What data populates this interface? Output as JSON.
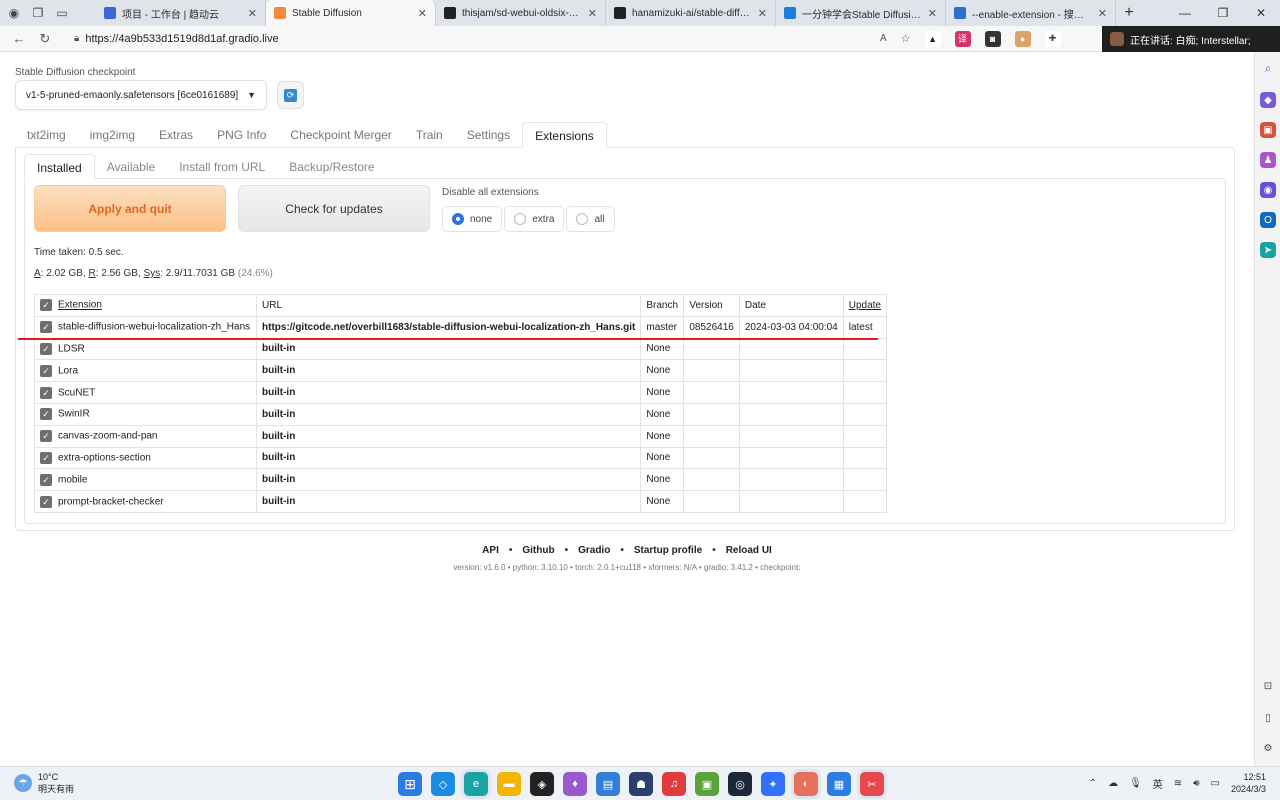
{
  "browser": {
    "tabs": [
      {
        "title": "项目 - 工作台 | 趋动云",
        "color": "#3a67d8",
        "active": false
      },
      {
        "title": "Stable Diffusion",
        "color": "#f08a3c",
        "active": true
      },
      {
        "title": "thisjam/sd-webui-oldsix-prom",
        "color": "#222222",
        "active": false
      },
      {
        "title": "hanamizuki-ai/stable-diffusion",
        "color": "#222222",
        "active": false
      },
      {
        "title": "一分钟学会Stable Diffusion设置",
        "color": "#1e7fe0",
        "active": false
      },
      {
        "title": "--enable-extension - 搜索 ---",
        "color": "#2d6fd6",
        "active": false
      }
    ],
    "url": "https://4a9b533d1519d8d1af.gradio.live",
    "speaking_text": "正在讲话:   白痴; Interstellar;"
  },
  "checkpoint": {
    "label": "Stable Diffusion checkpoint",
    "value": "v1-5-pruned-emaonly.safetensors [6ce0161689]"
  },
  "main_tabs": [
    "txt2img",
    "img2img",
    "Extras",
    "PNG Info",
    "Checkpoint Merger",
    "Train",
    "Settings",
    "Extensions"
  ],
  "sub_tabs": [
    "Installed",
    "Available",
    "Install from URL",
    "Backup/Restore"
  ],
  "buttons": {
    "apply": "Apply and quit",
    "check": "Check for updates"
  },
  "disable": {
    "label": "Disable all extensions",
    "options": [
      "none",
      "extra",
      "all"
    ],
    "selected": "none"
  },
  "status": {
    "time_taken": "Time taken: 0.5 sec.",
    "mem_a_label": "A",
    "mem_a": ": 2.02 GB, ",
    "mem_r_label": "R",
    "mem_r": ": 2.56 GB, ",
    "mem_sys_label": "Sys",
    "mem_sys": ": 2.9/11.7031 GB ",
    "mem_pct": "(24.6%)"
  },
  "table": {
    "headers": [
      "Extension",
      "URL",
      "Branch",
      "Version",
      "Date",
      "Update"
    ],
    "rows": [
      [
        "stable-diffusion-webui-localization-zh_Hans",
        "https://gitcode.net/overbill1683/stable-diffusion-webui-localization-zh_Hans.git",
        "master",
        "08526416",
        "2024-03-03 04:00:04",
        "latest"
      ],
      [
        "LDSR",
        "built-in",
        "None",
        "",
        "",
        ""
      ],
      [
        "Lora",
        "built-in",
        "None",
        "",
        "",
        ""
      ],
      [
        "ScuNET",
        "built-in",
        "None",
        "",
        "",
        ""
      ],
      [
        "SwinIR",
        "built-in",
        "None",
        "",
        "",
        ""
      ],
      [
        "canvas-zoom-and-pan",
        "built-in",
        "None",
        "",
        "",
        ""
      ],
      [
        "extra-options-section",
        "built-in",
        "None",
        "",
        "",
        ""
      ],
      [
        "mobile",
        "built-in",
        "None",
        "",
        "",
        ""
      ],
      [
        "prompt-bracket-checker",
        "built-in",
        "None",
        "",
        "",
        ""
      ]
    ]
  },
  "footer": {
    "links": [
      "API",
      "Github",
      "Gradio",
      "Startup profile",
      "Reload UI"
    ],
    "version": "version: v1.6.0  •  python: 3.10.10  •  torch: 2.0.1+cu118  •  xformers: N/A  •  gradio: 3.41.2  •  checkpoint:"
  },
  "taskbar": {
    "temp": "10°C",
    "weather": "明天有雨",
    "ime": "英",
    "time": "12:51",
    "date": "2024/3/3"
  }
}
